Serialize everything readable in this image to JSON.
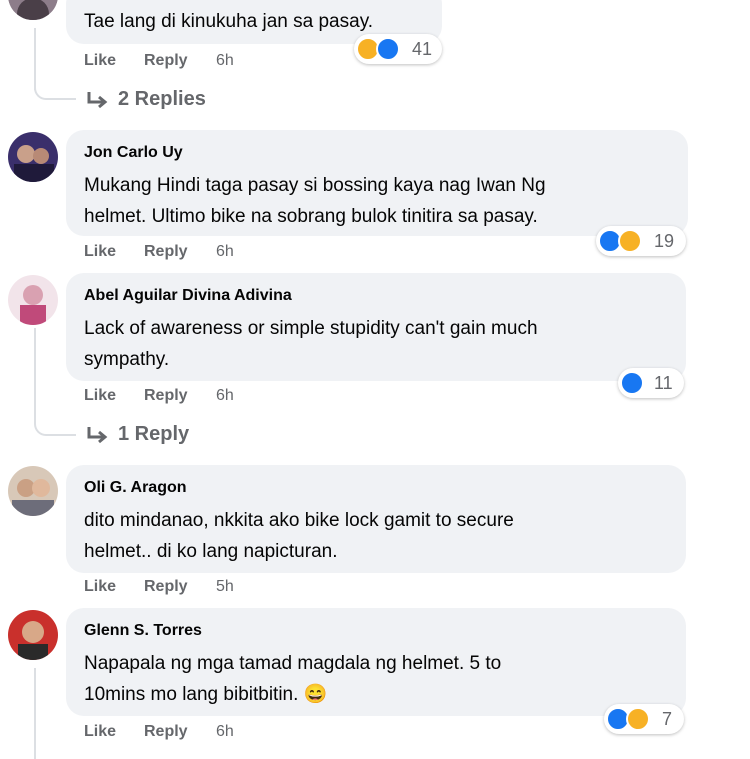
{
  "comments": [
    {
      "author": "",
      "lines": [
        "Tae lang di kinukuha jan sa pasay."
      ],
      "actions": {
        "like": "Like",
        "reply": "Reply",
        "time": "6h"
      },
      "reactions": {
        "icons": [
          "haha-icon",
          "like-icon"
        ],
        "count": "41"
      },
      "replies": "2 Replies"
    },
    {
      "author": "Jon Carlo Uy",
      "lines": [
        "Mukang Hindi taga pasay si bossing kaya nag Iwan Ng",
        "helmet. Ultimo bike na sobrang bulok tinitira sa pasay."
      ],
      "actions": {
        "like": "Like",
        "reply": "Reply",
        "time": "6h"
      },
      "reactions": {
        "icons": [
          "like-icon",
          "haha-icon"
        ],
        "count": "19"
      }
    },
    {
      "author": "Abel Aguilar Divina Adivina",
      "lines": [
        "Lack of awareness or simple stupidity can't gain much",
        "sympathy."
      ],
      "actions": {
        "like": "Like",
        "reply": "Reply",
        "time": "6h"
      },
      "reactions": {
        "icons": [
          "like-icon"
        ],
        "count": "11"
      },
      "replies": "1 Reply"
    },
    {
      "author": "Oli G. Aragon",
      "lines": [
        "dito mindanao, nkkita ako bike lock gamit to secure",
        "helmet.. di ko lang napicturan."
      ],
      "actions": {
        "like": "Like",
        "reply": "Reply",
        "time": "5h"
      }
    },
    {
      "author": "Glenn S. Torres",
      "lines": [
        "Napapala ng mga tamad magdala ng helmet. 5 to",
        "10mins mo lang bibitbitin. 😄"
      ],
      "actions": {
        "like": "Like",
        "reply": "Reply",
        "time": "6h"
      },
      "reactions": {
        "icons": [
          "like-icon",
          "haha-icon"
        ],
        "count": "7"
      }
    }
  ],
  "colors": {
    "bubble": "#f0f2f5",
    "secondary_text": "#65676b",
    "like_blue": "#1877f2",
    "haha_yellow": "#f7b125"
  }
}
